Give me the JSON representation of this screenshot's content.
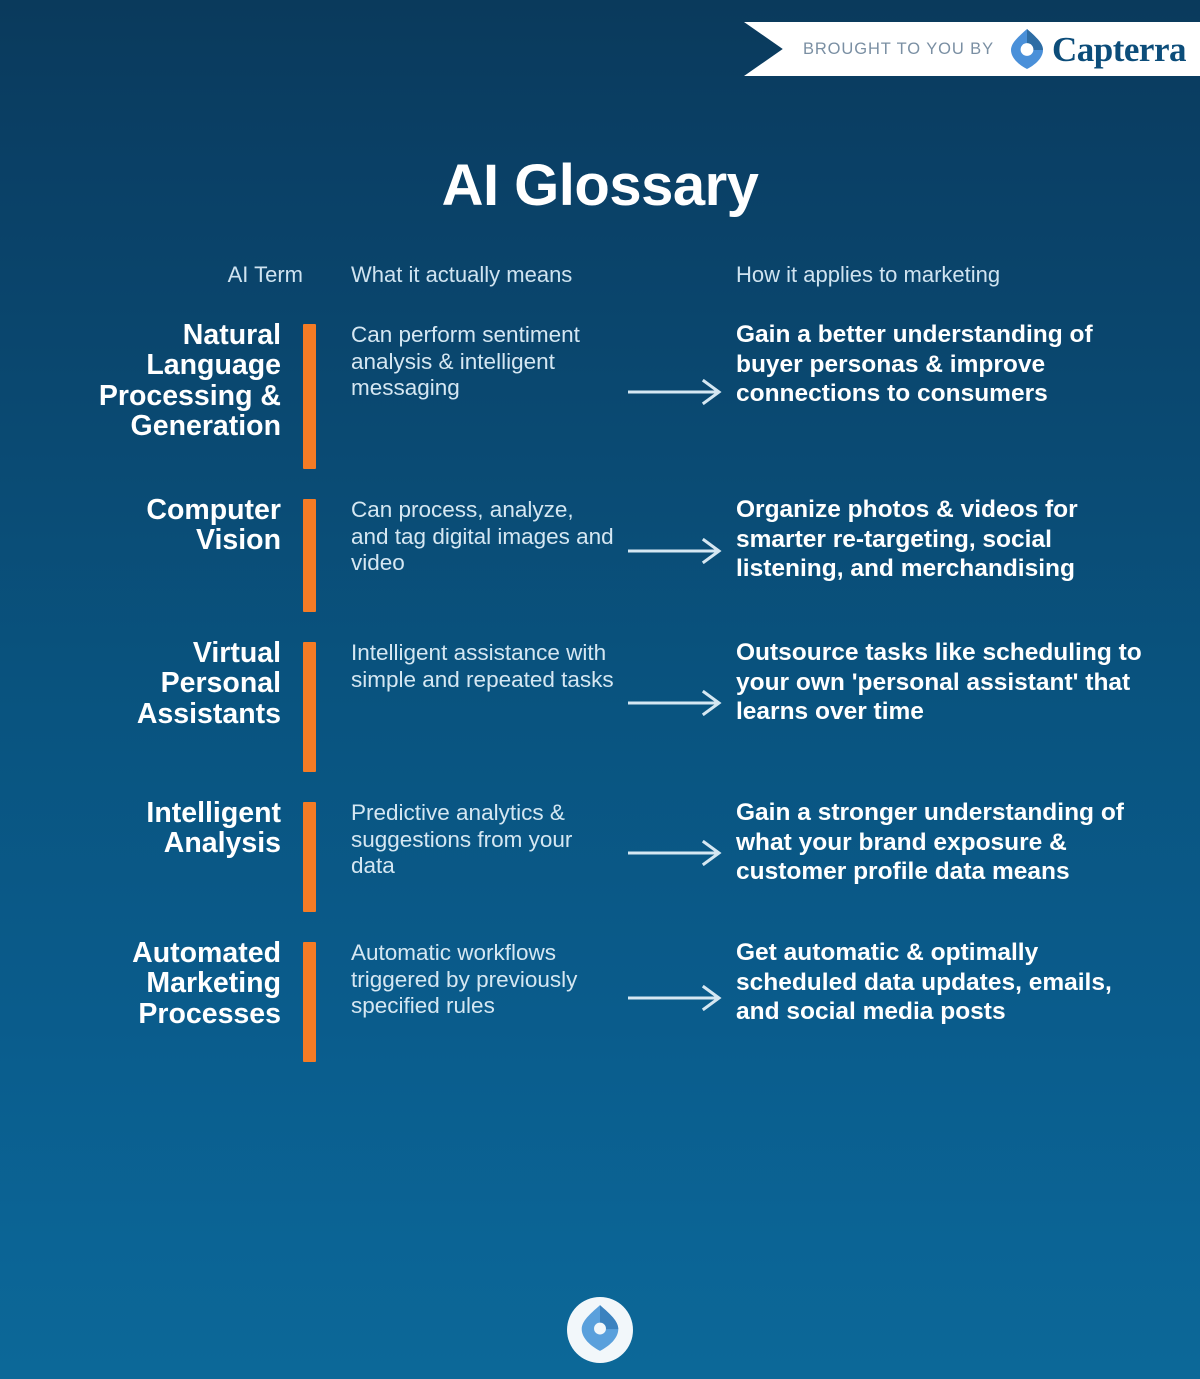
{
  "banner": {
    "text": "BROUGHT TO YOU BY",
    "brand": "Capterra",
    "logo_icon": "capterra-diamond-icon"
  },
  "page_title": "AI Glossary",
  "headers": {
    "term": "AI Term",
    "meaning": "What it actually means",
    "marketing": "How it applies to marketing"
  },
  "colors": {
    "accent_orange": "#f47b25",
    "background_top": "#0a3a5c",
    "background_bottom": "#0c6898",
    "brand_blue": "#0c4d7a",
    "text_white": "#ffffff",
    "text_pale_blue": "#d5e7f2"
  },
  "rows": [
    {
      "term": "Natural Language Processing & Generation",
      "meaning": "Can perform sentiment analysis & intelligent messaging",
      "marketing": "Gain a better understanding of buyer personas & improve connections to consumers",
      "arrow_icon": "arrow-right-icon"
    },
    {
      "term": "Computer Vision",
      "meaning": "Can process, analyze, and tag digital images and video",
      "marketing": "Organize photos & videos for smarter re-targeting, social listening, and merchandising",
      "arrow_icon": "arrow-right-icon"
    },
    {
      "term": "Virtual Personal Assistants",
      "meaning": "Intelligent assistance with simple and repeated tasks",
      "marketing": "Outsource tasks like scheduling to your own 'personal assistant' that learns over time",
      "arrow_icon": "arrow-right-icon"
    },
    {
      "term": "Intelligent Analysis",
      "meaning": "Predictive analytics & suggestions from your data",
      "marketing": "Gain a stronger understanding of what your brand exposure & customer profile data means",
      "arrow_icon": "arrow-right-icon"
    },
    {
      "term": "Automated Marketing Processes",
      "meaning": "Automatic workflows triggered by previously specified rules",
      "marketing": "Get automatic & optimally scheduled data updates, emails, and social media posts",
      "arrow_icon": "arrow-right-icon"
    }
  ],
  "footer": {
    "logo_icon": "capterra-diamond-icon"
  }
}
